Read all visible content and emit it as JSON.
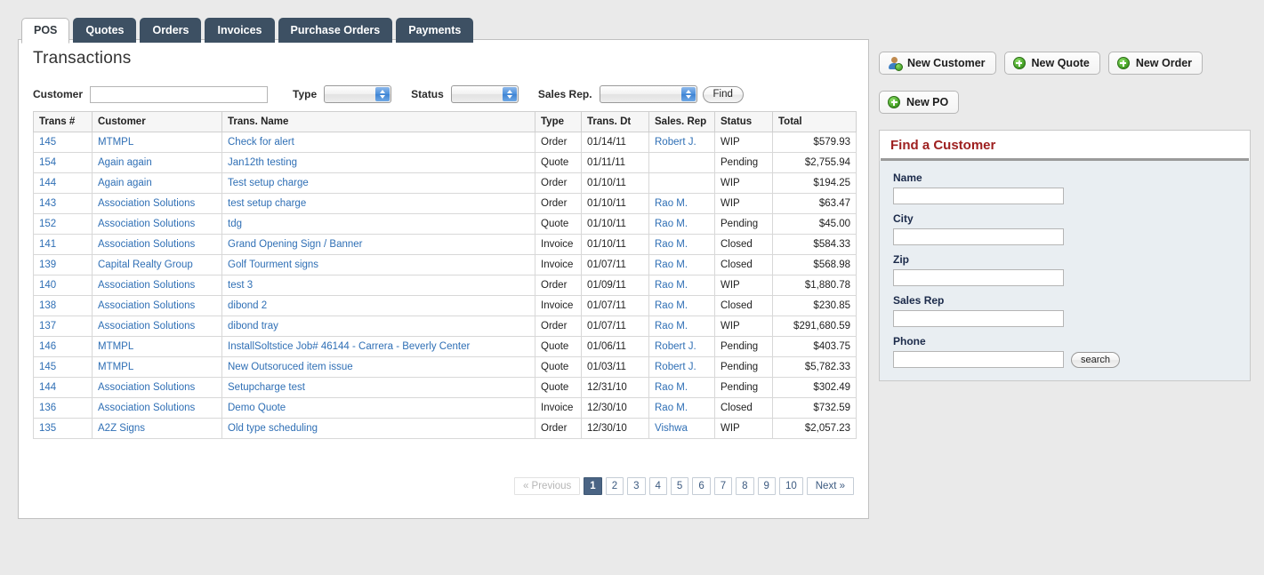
{
  "tabs": [
    {
      "label": "POS",
      "active": true
    },
    {
      "label": "Quotes",
      "active": false
    },
    {
      "label": "Orders",
      "active": false
    },
    {
      "label": "Invoices",
      "active": false
    },
    {
      "label": "Purchase Orders",
      "active": false
    },
    {
      "label": "Payments",
      "active": false
    }
  ],
  "main": {
    "title": "Transactions",
    "filters": {
      "customer_label": "Customer",
      "customer_value": "",
      "type_label": "Type",
      "type_value": "",
      "status_label": "Status",
      "status_value": "",
      "sales_rep_label": "Sales Rep.",
      "sales_rep_value": "",
      "find_button": "Find"
    },
    "table": {
      "columns": [
        "Trans #",
        "Customer",
        "Trans. Name",
        "Type",
        "Trans. Dt",
        "Sales. Rep",
        "Status",
        "Total"
      ],
      "rows": [
        {
          "trans": "145",
          "customer": "MTMPL",
          "name": "Check for alert",
          "type": "Order",
          "date": "01/14/11",
          "rep": "Robert J.",
          "status": "WIP",
          "total": "$579.93"
        },
        {
          "trans": "154",
          "customer": "Again again",
          "name": "Jan12th testing",
          "type": "Quote",
          "date": "01/11/11",
          "rep": "",
          "status": "Pending",
          "total": "$2,755.94"
        },
        {
          "trans": "144",
          "customer": "Again again",
          "name": "Test setup charge",
          "type": "Order",
          "date": "01/10/11",
          "rep": "",
          "status": "WIP",
          "total": "$194.25"
        },
        {
          "trans": "143",
          "customer": "Association Solutions",
          "name": "test setup charge",
          "type": "Order",
          "date": "01/10/11",
          "rep": "Rao M.",
          "status": "WIP",
          "total": "$63.47"
        },
        {
          "trans": "152",
          "customer": "Association Solutions",
          "name": "tdg",
          "type": "Quote",
          "date": "01/10/11",
          "rep": "Rao M.",
          "status": "Pending",
          "total": "$45.00"
        },
        {
          "trans": "141",
          "customer": "Association Solutions",
          "name": "Grand Opening Sign / Banner",
          "type": "Invoice",
          "date": "01/10/11",
          "rep": "Rao M.",
          "status": "Closed",
          "total": "$584.33"
        },
        {
          "trans": "139",
          "customer": "Capital Realty Group",
          "name": "Golf Tourment signs",
          "type": "Invoice",
          "date": "01/07/11",
          "rep": "Rao M.",
          "status": "Closed",
          "total": "$568.98"
        },
        {
          "trans": "140",
          "customer": "Association Solutions",
          "name": "test 3",
          "type": "Order",
          "date": "01/09/11",
          "rep": "Rao M.",
          "status": "WIP",
          "total": "$1,880.78"
        },
        {
          "trans": "138",
          "customer": "Association Solutions",
          "name": "dibond 2",
          "type": "Invoice",
          "date": "01/07/11",
          "rep": "Rao M.",
          "status": "Closed",
          "total": "$230.85"
        },
        {
          "trans": "137",
          "customer": "Association Solutions",
          "name": "dibond tray",
          "type": "Order",
          "date": "01/07/11",
          "rep": "Rao M.",
          "status": "WIP",
          "total": "$291,680.59"
        },
        {
          "trans": "146",
          "customer": "MTMPL",
          "name": "InstallSoltstice Job# 46144 - Carrera - Beverly Center",
          "type": "Quote",
          "date": "01/06/11",
          "rep": "Robert J.",
          "status": "Pending",
          "total": "$403.75"
        },
        {
          "trans": "145",
          "customer": "MTMPL",
          "name": "New Outsoruced item issue",
          "type": "Quote",
          "date": "01/03/11",
          "rep": "Robert J.",
          "status": "Pending",
          "total": "$5,782.33"
        },
        {
          "trans": "144",
          "customer": "Association Solutions",
          "name": "Setupcharge test",
          "type": "Quote",
          "date": "12/31/10",
          "rep": "Rao M.",
          "status": "Pending",
          "total": "$302.49"
        },
        {
          "trans": "136",
          "customer": "Association Solutions",
          "name": "Demo Quote",
          "type": "Invoice",
          "date": "12/30/10",
          "rep": "Rao M.",
          "status": "Closed",
          "total": "$732.59"
        },
        {
          "trans": "135",
          "customer": "A2Z Signs",
          "name": "Old type scheduling",
          "type": "Order",
          "date": "12/30/10",
          "rep": "Vishwa",
          "status": "WIP",
          "total": "$2,057.23"
        }
      ]
    },
    "pagination": {
      "previous": "« Previous",
      "pages": [
        "1",
        "2",
        "3",
        "4",
        "5",
        "6",
        "7",
        "8",
        "9",
        "10"
      ],
      "active_page": "1",
      "next": "Next »"
    }
  },
  "sidebar": {
    "buttons": [
      {
        "label": "New Customer",
        "icon": "user-add-icon"
      },
      {
        "label": "New Quote",
        "icon": "plus-circle-icon"
      },
      {
        "label": "New Order",
        "icon": "plus-circle-icon"
      },
      {
        "label": "New PO",
        "icon": "plus-circle-icon"
      }
    ],
    "find_customer": {
      "title": "Find a Customer",
      "fields": [
        {
          "label": "Name",
          "value": ""
        },
        {
          "label": "City",
          "value": ""
        },
        {
          "label": "Zip",
          "value": ""
        },
        {
          "label": "Sales Rep",
          "value": ""
        },
        {
          "label": "Phone",
          "value": ""
        }
      ],
      "search_button": "search"
    }
  },
  "colors": {
    "tab_inactive": "#3d5063",
    "link": "#2f6fb5",
    "pager_active": "#4a6484",
    "find_title": "#9e2020",
    "panel_body": "#e9eef2",
    "page_bg": "#eaeaea"
  }
}
